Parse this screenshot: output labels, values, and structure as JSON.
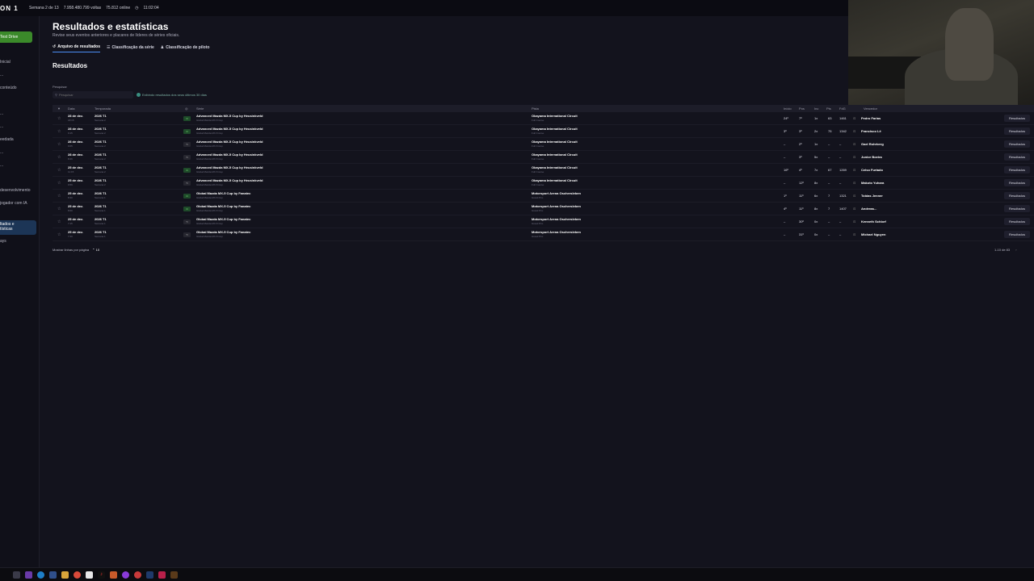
{
  "topbar": {
    "logo": "ON 1",
    "week": "Semana 2 de 13",
    "laps": "7.958.480.799 voltas",
    "online": "75.812 online",
    "clock": "11:02:04"
  },
  "sidebar": {
    "drive": "Test Drive",
    "items": [
      "Inicial",
      "...",
      "conteúdo",
      "...",
      "...",
      "...",
      "eedada",
      "...",
      "...",
      "...",
      "desenvolvimento",
      "jogador com IA"
    ],
    "active_line1": "ltados e",
    "active_line2": "tísticas",
    "last": "ays"
  },
  "header": {
    "title": "Resultados e estatísticas",
    "subtitle": "Revise seus eventos anteriores e placares de líderes de séries oficiais."
  },
  "tabs": [
    {
      "label": "Arquivo de resultados",
      "icon": "history-icon"
    },
    {
      "label": "Classificação da série",
      "icon": "list-icon"
    },
    {
      "label": "Classificação de piloto",
      "icon": "person-icon"
    }
  ],
  "section_title": "Resultados",
  "search": {
    "label": "Pesquisar",
    "placeholder": "Pesquisar"
  },
  "info_text": "Exibindo resultados dos seus últimos 30 dias",
  "columns": {
    "date": "Data",
    "season": "Temporada",
    "series": "Série",
    "track": "Pista",
    "start": "Início",
    "pos": "Pos",
    "inc": "Inc",
    "pts": "Pts",
    "sof": "FdG",
    "winner": "Vencedor"
  },
  "rows": [
    {
      "date": "28 de dez.",
      "time": "18:15",
      "season": "2026 T1",
      "week": "Semana 2",
      "lic": "Cl",
      "series": "Advanced Mazda MX-5 Cup by Heusinkveld",
      "car": "Global Mazda MX-5 Cup",
      "track": "Okayama International Circuit",
      "config": "Full Course",
      "start": "24º",
      "pos": "7º",
      "inc": "1x",
      "pts": "63",
      "sof": "1461",
      "winner": "Pedro Farias",
      "btn": "Resultados"
    },
    {
      "date": "28 de dez.",
      "time": "9:15",
      "season": "2026 T1",
      "week": "Semana 2",
      "lic": "Cl",
      "series": "Advanced Mazda MX-5 Cup by Heusinkveld",
      "car": "Global Mazda MX-5 Cup",
      "track": "Okayama International Circuit",
      "config": "Full Course",
      "start": "3º",
      "pos": "3º",
      "inc": "2x",
      "pts": "75",
      "sof": "1342",
      "winner": "Francisco Lê",
      "btn": "Resultados"
    },
    {
      "date": "28 de dez.",
      "time": "9:05",
      "season": "2026 T1",
      "week": "Semana 2",
      "lic": "Tr",
      "series": "Advanced Mazda MX-5 Cup by Heusinkveld",
      "car": "Global Mazda MX-5 Cup",
      "track": "Okayama International Circuit",
      "config": "Full Course",
      "start": "–",
      "pos": "2º",
      "inc": "1x",
      "pts": "–",
      "sof": "–",
      "winner": "Gael Rohrberg",
      "btn": "Resultados"
    },
    {
      "date": "28 de dez.",
      "time": "8:46",
      "season": "2026 T1",
      "week": "Semana 2",
      "lic": "Tr",
      "series": "Advanced Mazda MX-5 Cup by Heusinkveld",
      "car": "Global Mazda MX-5 Cup",
      "track": "Okayama International Circuit",
      "config": "Full Course",
      "start": "–",
      "pos": "3º",
      "inc": "5x",
      "pts": "–",
      "sof": "–",
      "winner": "Junior Boeira",
      "btn": "Resultados"
    },
    {
      "date": "25 de dez.",
      "time": "11:15",
      "season": "2026 T1",
      "week": "Semana 2",
      "lic": "Cl",
      "series": "Advanced Mazda MX-5 Cup by Heusinkveld",
      "car": "Global Mazda MX-5 Cup",
      "track": "Okayama International Circuit",
      "config": "Full Course",
      "start": "16º",
      "pos": "4º",
      "inc": "7x",
      "pts": "67",
      "sof": "1269",
      "winner": "Celso Furtado",
      "btn": "Resultados"
    },
    {
      "date": "25 de dez.",
      "time": "9:59",
      "season": "2026 T1",
      "week": "Semana 2",
      "lic": "Tr",
      "series": "Advanced Mazda MX-5 Cup by Heusinkveld",
      "car": "Global Mazda MX-5 Cup",
      "track": "Okayama International Circuit",
      "config": "Full Course",
      "start": "–",
      "pos": "12º",
      "inc": "8x",
      "pts": "–",
      "sof": "–",
      "winner": "Makoto Yuhara",
      "btn": "Resultados"
    },
    {
      "date": "25 de dez.",
      "time": "8:30",
      "season": "2026 T1",
      "week": "Semana 1",
      "lic": "Cl",
      "series": "Global Mazda MX-5 Cup by Fanatec",
      "car": "Global Mazda MX-5 Cup",
      "track": "Motorsport Arena Oschersleben",
      "config": "Grand Prix",
      "start": "1º",
      "pos": "11º",
      "inc": "6x",
      "pts": "7",
      "sof": "1321",
      "winner": "Tobias Jenner",
      "btn": "Resultados"
    },
    {
      "date": "25 de dez.",
      "time": "8:00",
      "season": "2026 T1",
      "week": "Semana 1",
      "lic": "Cl",
      "series": "Global Mazda MX-5 Cup by Fanatec",
      "car": "Global Mazda MX-5 Cup",
      "track": "Motorsport Arena Oschersleben",
      "config": "Grand Prix",
      "start": "4º",
      "pos": "11º",
      "inc": "8x",
      "pts": "7",
      "sof": "1407",
      "winner": "Andreas...",
      "btn": "Resultados"
    },
    {
      "date": "25 de dez.",
      "time": "7:15",
      "season": "2026 T1",
      "week": "Semana 1",
      "lic": "Tr",
      "series": "Global Mazda MX-5 Cup by Fanatec",
      "car": "Global Mazda MX-5 Cup",
      "track": "Motorsport Arena Oschersleben",
      "config": "Grand Prix",
      "start": "–",
      "pos": "30º",
      "inc": "0x",
      "pts": "–",
      "sof": "–",
      "winner": "Kenneth Schlorf",
      "btn": "Resultados"
    },
    {
      "date": "25 de dez.",
      "time": "7:40",
      "season": "2026 T1",
      "week": "Semana 1",
      "lic": "Tr",
      "series": "Global Mazda MX-5 Cup by Fanatec",
      "car": "Global Mazda MX-5 Cup",
      "track": "Motorsport Arena Oschersleben",
      "config": "Grand Prix",
      "start": "–",
      "pos": "31º",
      "inc": "0x",
      "pts": "–",
      "sof": "–",
      "winner": "Michael Nguyen",
      "btn": "Resultados"
    }
  ],
  "footer": {
    "rows_label": "Mostrar linhas por página",
    "rows_value": "10",
    "range": "1-10 de 83"
  },
  "colors": {
    "accent": "#4b8ef5",
    "drive": "#3b8a2a",
    "lic_cl": "#1f4a2a",
    "lic_tr": "#26262f"
  }
}
